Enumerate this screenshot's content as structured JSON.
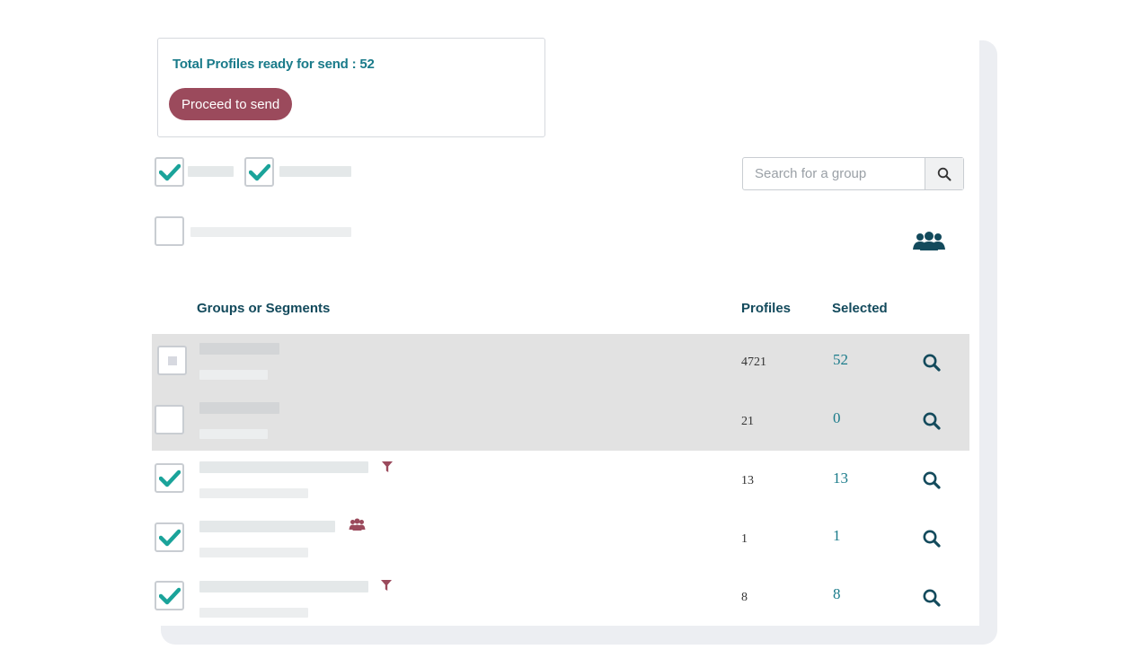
{
  "summary": {
    "text": "Total Profiles ready for send : 52",
    "button_label": "Proceed to send"
  },
  "filters": {
    "checkbox_1_checked": true,
    "checkbox_2_checked": true,
    "checkbox_3_checked": false
  },
  "search": {
    "placeholder": "Search for a group",
    "icon": "search-icon"
  },
  "toolbar": {
    "groups_icon": "users-icon"
  },
  "table": {
    "headers": {
      "name": "Groups or Segments",
      "profiles": "Profiles",
      "selected": "Selected"
    },
    "rows": [
      {
        "state": "partial",
        "profiles": "4721",
        "selected": "52",
        "tag_icon": "",
        "highlighted": true
      },
      {
        "state": "unchecked",
        "profiles": "21",
        "selected": "0",
        "tag_icon": "",
        "highlighted": true
      },
      {
        "state": "checked",
        "profiles": "13",
        "selected": "13",
        "tag_icon": "filter-icon",
        "highlighted": false
      },
      {
        "state": "checked",
        "profiles": "1",
        "selected": "1",
        "tag_icon": "users-icon",
        "highlighted": false
      },
      {
        "state": "checked",
        "profiles": "8",
        "selected": "8",
        "tag_icon": "filter-icon",
        "highlighted": false
      }
    ]
  },
  "colors": {
    "accent": "#1a7b8a",
    "button": "#9b4a5c",
    "check": "#1aa39a",
    "header": "#134a5c"
  }
}
